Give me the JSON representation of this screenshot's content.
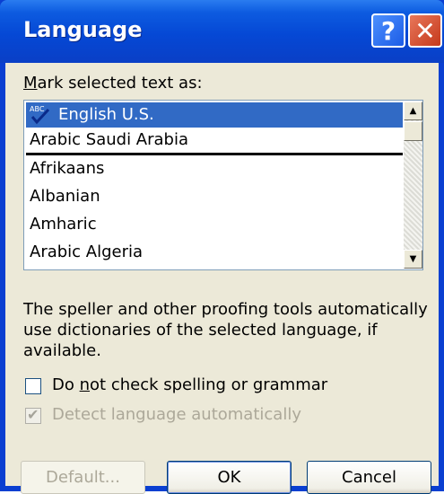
{
  "window": {
    "title": "Language",
    "help_glyph": "?",
    "close_glyph": "✕"
  },
  "mark_label": "Mark selected text as:",
  "list": {
    "selected_item": "English U.S.",
    "recent_items": [
      "English U.S.",
      "Arabic Saudi Arabia"
    ],
    "items": [
      "Afrikaans",
      "Albanian",
      "Amharic",
      "Arabic Algeria"
    ]
  },
  "description": "The speller and other proofing tools automatically use dictionaries of the selected language, if available.",
  "checkboxes": {
    "no_check": {
      "label": "Do not check spelling or grammar",
      "checked": false,
      "enabled": true
    },
    "detect": {
      "label": "Detect language automatically",
      "checked": true,
      "enabled": false
    }
  },
  "buttons": {
    "default_label": "Default...",
    "ok_label": "OK",
    "cancel_label": "Cancel"
  },
  "colors": {
    "titlebar": "#0548d5",
    "selection": "#316ac5",
    "dialog_bg": "#ece9d8"
  }
}
